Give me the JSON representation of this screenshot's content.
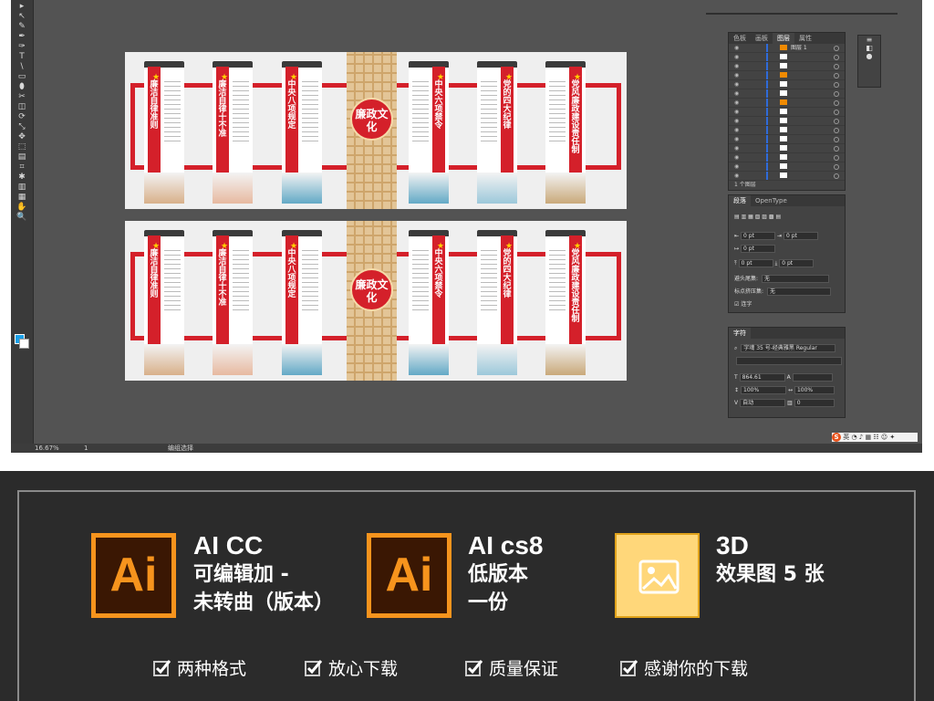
{
  "app": {
    "tools": [
      "▸",
      "↖",
      "✎",
      "✒",
      "✑",
      "T",
      "\\",
      "▭",
      "⬮",
      "✂",
      "◫",
      "⟳",
      "⤡",
      "✥",
      "⬚",
      "▤",
      "⌗",
      "✱",
      "▥",
      "▦",
      "✋",
      "🔍"
    ],
    "status": {
      "zoom": "16.67%",
      "page": "1",
      "mode": "编组选择"
    }
  },
  "artwork": {
    "center_title": "廉政文化",
    "panels": [
      {
        "title": "廉洁自律准则"
      },
      {
        "title": "廉洁自律十不准"
      },
      {
        "title": "中央八项规定"
      },
      {
        "title": "中央六项禁令"
      },
      {
        "title": "党的四大纪律"
      },
      {
        "title": "党风廉政建设责任制"
      }
    ]
  },
  "layers_panel": {
    "tabs": [
      "色板",
      "画板",
      "图层",
      "属性"
    ],
    "active_tab": "图层",
    "top_layer": "图层 1",
    "footer": "1 个图层"
  },
  "paragraph_panel": {
    "tabs": [
      "段落",
      "OpenType"
    ],
    "indent_values": [
      "0 pt",
      "0 pt",
      "0 pt",
      "0 pt",
      "0 pt"
    ],
    "label_1": "避头尾集:",
    "value_1": "无",
    "label_2": "标点挤压集:",
    "value_2": "无",
    "checkbox": "连字"
  },
  "character_panel": {
    "title": "字符",
    "font": "字魂 35 号-经典雅黑 Regular",
    "size": "864.61",
    "leading": "",
    "scale_v": "100%",
    "scale_h": "100%",
    "tracking_auto": "自动",
    "tracking": "0"
  },
  "ime": {
    "logo": "S",
    "label": "英"
  },
  "promo": {
    "badge1": {
      "icon": "Ai",
      "title": "AI CC",
      "line1": "可编辑加 -",
      "line2": "未转曲（版本）"
    },
    "badge2": {
      "icon": "Ai",
      "title": "AI cs8",
      "line1": "低版本",
      "line2": "一份"
    },
    "badge3": {
      "title": "3D",
      "line1": "效果图 5 张"
    },
    "features": [
      "两种格式",
      "放心下载",
      "质量保证",
      "感谢你的下载"
    ]
  },
  "colors": {
    "accent_red": "#d4202a",
    "ai_orange": "#f7941d",
    "ai_bg": "#3a1703",
    "panel_bg": "#434343"
  }
}
